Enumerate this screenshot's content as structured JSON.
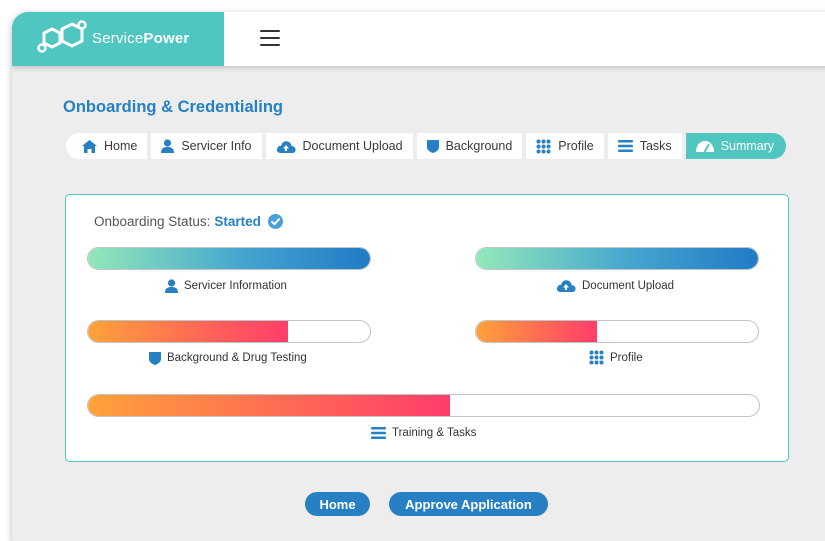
{
  "brand": {
    "name_prefix": "Service",
    "name_bold": "Power"
  },
  "colors": {
    "teal": "#4fc6c0",
    "blue": "#2680c3",
    "green_gradient": [
      "#93e8b9",
      "#1f7cc6"
    ],
    "warm_gradient": [
      "#ffa23a",
      "#ff3d6b"
    ]
  },
  "page_title": "Onboarding & Credentialing",
  "tabs": [
    {
      "label": "Home",
      "icon": "home-icon"
    },
    {
      "label": "Servicer Info",
      "icon": "user-icon"
    },
    {
      "label": "Document Upload",
      "icon": "cloud-upload-icon"
    },
    {
      "label": "Background",
      "icon": "shield-icon"
    },
    {
      "label": "Profile",
      "icon": "grid-icon"
    },
    {
      "label": "Tasks",
      "icon": "list-icon"
    },
    {
      "label": "Summary",
      "icon": "dashboard-icon",
      "active": true
    }
  ],
  "status": {
    "label": "Onboarding Status:",
    "value": "Started",
    "icon": "check-circle-icon"
  },
  "progress": [
    {
      "label": "Servicer Information",
      "icon": "user-icon",
      "fraction": 1.0
    },
    {
      "label": "Document Upload",
      "icon": "cloud-upload-icon",
      "fraction": 1.0
    },
    {
      "label": "Background & Drug Testing",
      "icon": "shield-icon",
      "fraction": 0.71
    },
    {
      "label": "Profile",
      "icon": "grid-icon",
      "fraction": 0.43
    },
    {
      "label": "Training & Tasks",
      "icon": "list-icon",
      "fraction": 0.54
    }
  ],
  "buttons": {
    "home": "Home",
    "approve": "Approve Application"
  }
}
